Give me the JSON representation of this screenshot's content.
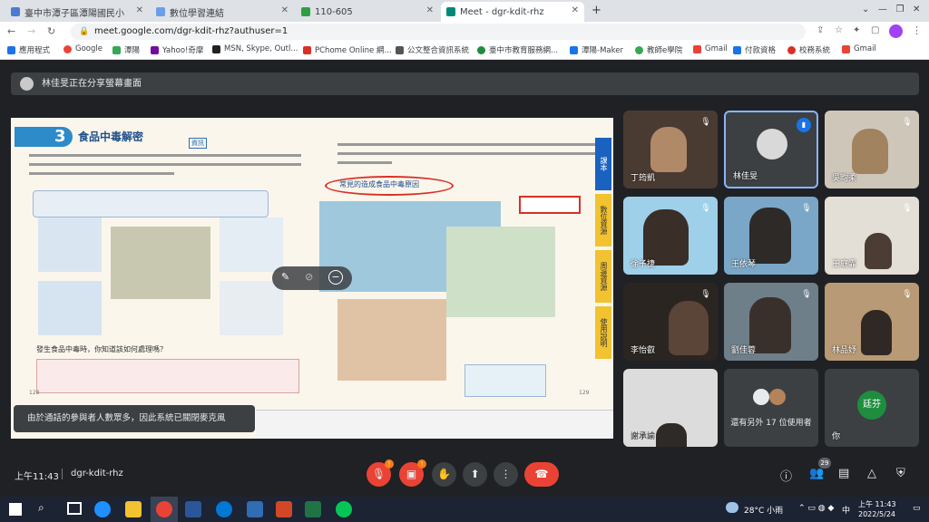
{
  "browser": {
    "tabs": [
      {
        "label": "臺中市潭子區潭陽國民小學"
      },
      {
        "label": "數位學習連結"
      },
      {
        "label": "110-605"
      },
      {
        "label": "Meet - dgr-kdit-rhz"
      }
    ],
    "new_tab": "+",
    "url": "meet.google.com/dgr-kdit-rhz?authuser=1",
    "bookmarks": [
      "應用程式",
      "Google",
      "潭陽",
      "Yahoo!奇摩",
      "MSN, Skype, Outl...",
      "PChome Online 網...",
      "公文整合資訊系統",
      "臺中市教育服務網...",
      "潭陽-Maker",
      "教師e學院",
      "Gmail",
      "付款資格",
      "校務系統",
      "Gmail"
    ]
  },
  "meet": {
    "presenting_text": "林佳旻正在分享螢幕畫面",
    "muted_notice": "由於通話的參與者人數眾多，因此系統已關閉麥克風",
    "time": "上午11:43",
    "meeting_code": "dgr-kdit-rhz",
    "participant_count": "29",
    "participants": [
      {
        "name": "丁筠凱"
      },
      {
        "name": "林佳旻"
      },
      {
        "name": "吳昀柔"
      },
      {
        "name": "徐子捷"
      },
      {
        "name": "王依琴"
      },
      {
        "name": "王庭霏"
      },
      {
        "name": "李怡叡"
      },
      {
        "name": "劉佳蓉"
      },
      {
        "name": "林品妤"
      },
      {
        "name": "謝承諭"
      },
      {
        "name": "還有另外 17 位使用者"
      },
      {
        "name": "你",
        "initials": "廷芬"
      }
    ]
  },
  "slide": {
    "title": "食品中毒解密",
    "number": "3",
    "tag": "資訊",
    "page_left": "128",
    "page_right": "129",
    "bubble_title": "常見的造成食品中毒原因",
    "side_tabs": [
      "課本",
      "數位資源",
      "周邊資源",
      "使用說明"
    ],
    "question": "發生食品中毒時，你知道該如何處理嗎？"
  },
  "taskbar": {
    "weather": "28°C 小雨",
    "lang": "中",
    "time": "上午 11:43",
    "date": "2022/5/24"
  }
}
